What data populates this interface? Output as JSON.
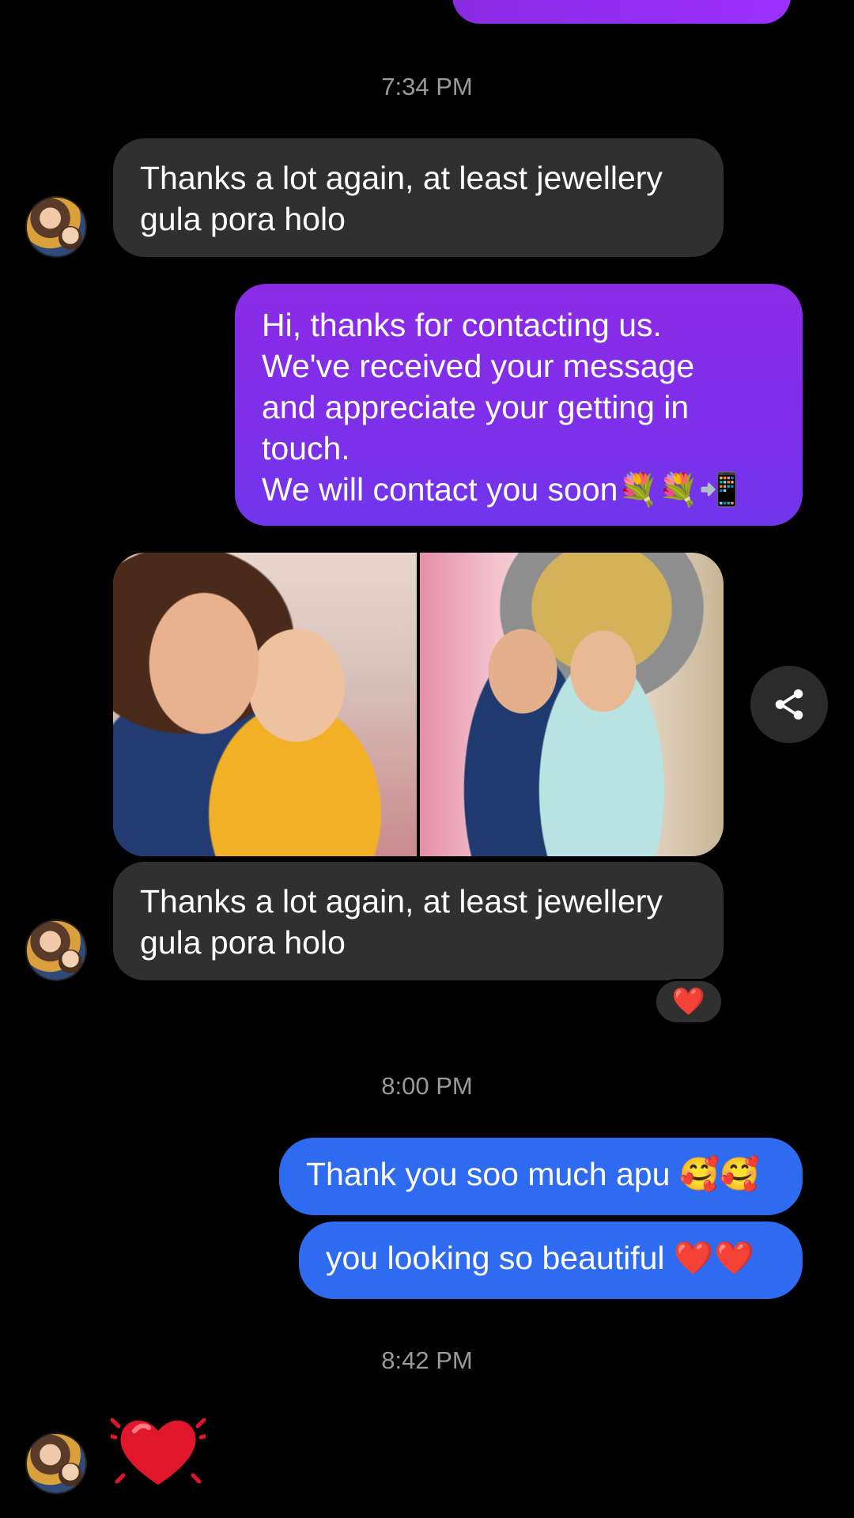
{
  "thread": {
    "timestamps": [
      "7:34 PM",
      "8:00 PM",
      "8:42 PM"
    ],
    "received_1": "Thanks a lot again, at least jewellery\ngula pora holo",
    "sent_auto_reply": "Hi, thanks for contacting us.\nWe've received your message\nand appreciate your getting in\ntouch.\nWe will contact you soon💐💐📲",
    "received_2": "Thanks a lot again, at least jewellery\ngula pora holo",
    "reaction": "❤️",
    "sent_1": "Thank you soo much apu 🥰🥰",
    "sent_2": "you looking so beautiful ❤️❤️"
  },
  "colors": {
    "background": "#000000",
    "received_bubble": "#303030",
    "sent_purple": "#8b2be8",
    "sent_blue": "#2f6bf0",
    "timestamp_text": "#9a9a9a"
  },
  "icons": {
    "share": "share-icon",
    "heart": "heart-icon"
  }
}
